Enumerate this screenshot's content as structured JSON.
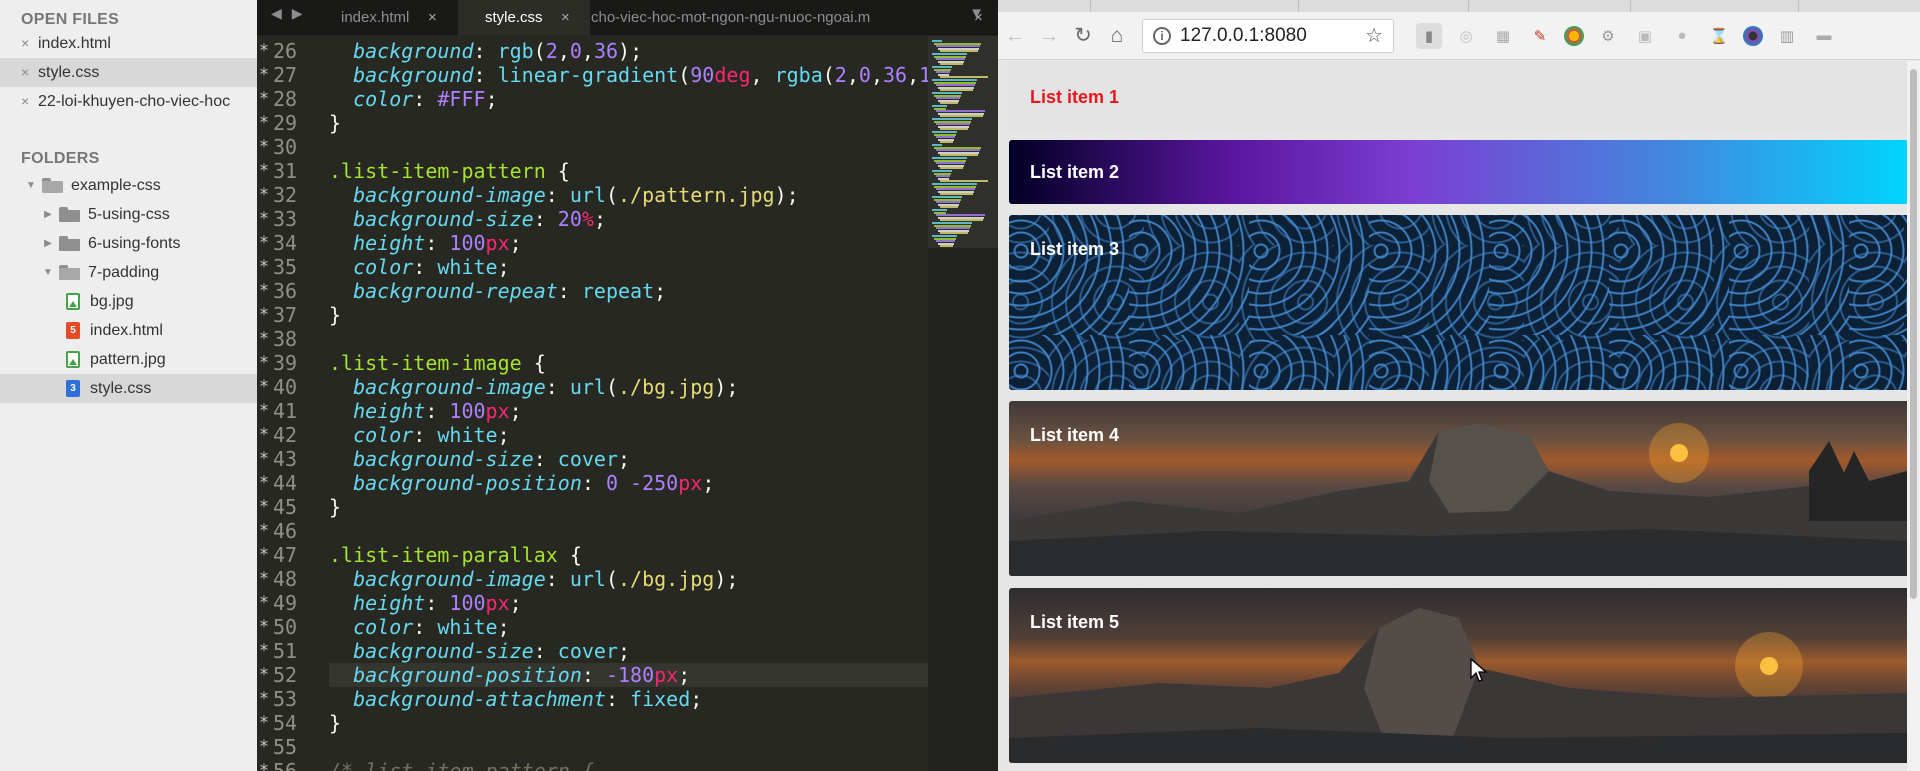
{
  "sidebar": {
    "open_files_heading": "OPEN FILES",
    "open_files": [
      {
        "name": "index.html",
        "selected": false
      },
      {
        "name": "style.css",
        "selected": true
      },
      {
        "name": "22-loi-khuyen-cho-viec-hoc",
        "selected": false
      }
    ],
    "folders_heading": "FOLDERS",
    "tree": [
      {
        "name": "example-css",
        "type": "folder",
        "open": true,
        "depth": 0,
        "icon": "folder-open-icon",
        "selected": false
      },
      {
        "name": "5-using-css",
        "type": "folder",
        "open": false,
        "depth": 1,
        "icon": "folder-icon",
        "selected": false
      },
      {
        "name": "6-using-fonts",
        "type": "folder",
        "open": false,
        "depth": 1,
        "icon": "folder-icon",
        "selected": false
      },
      {
        "name": "7-padding",
        "type": "folder",
        "open": true,
        "depth": 1,
        "icon": "folder-open-icon",
        "selected": false
      },
      {
        "name": "bg.jpg",
        "type": "image",
        "depth": 2,
        "icon": "image-file-icon",
        "selected": false
      },
      {
        "name": "index.html",
        "type": "html",
        "depth": 2,
        "icon": "html-file-icon",
        "selected": false
      },
      {
        "name": "pattern.jpg",
        "type": "image",
        "depth": 2,
        "icon": "image-file-icon",
        "selected": false
      },
      {
        "name": "style.css",
        "type": "css",
        "depth": 2,
        "icon": "css-file-icon",
        "selected": true
      }
    ]
  },
  "editor": {
    "tabs": [
      {
        "label": "index.html",
        "active": false
      },
      {
        "label": "style.css",
        "active": true
      },
      {
        "label": "cho-viec-hoc-mot-ngon-ngu-nuoc-ngoai.m",
        "active": false
      }
    ],
    "highlighted_line": 52,
    "lines": [
      {
        "n": "26",
        "tokens": [
          [
            "k",
            "  background"
          ],
          [
            "p",
            ": "
          ],
          [
            "f",
            "rgb"
          ],
          [
            "p",
            "("
          ],
          [
            "v",
            "2"
          ],
          [
            "p",
            ","
          ],
          [
            "v",
            "0"
          ],
          [
            "p",
            ","
          ],
          [
            "v",
            "36"
          ],
          [
            "p",
            ");"
          ]
        ]
      },
      {
        "n": "27",
        "tokens": [
          [
            "k",
            "  background"
          ],
          [
            "p",
            ": "
          ],
          [
            "f",
            "linear-gradient"
          ],
          [
            "p",
            "("
          ],
          [
            "v",
            "90"
          ],
          [
            "u",
            "deg"
          ],
          [
            "p",
            ", "
          ],
          [
            "f",
            "rgba"
          ],
          [
            "p",
            "("
          ],
          [
            "v",
            "2"
          ],
          [
            "p",
            ","
          ],
          [
            "v",
            "0"
          ],
          [
            "p",
            ","
          ],
          [
            "v",
            "36"
          ],
          [
            "p",
            ","
          ],
          [
            "v",
            "1"
          ]
        ]
      },
      {
        "n": "28",
        "tokens": [
          [
            "k",
            "  color"
          ],
          [
            "p",
            ": "
          ],
          [
            "v",
            "#FFF"
          ],
          [
            "p",
            ";"
          ]
        ]
      },
      {
        "n": "29",
        "tokens": [
          [
            "p",
            "}"
          ]
        ]
      },
      {
        "n": "30",
        "tokens": []
      },
      {
        "n": "31",
        "tokens": [
          [
            "s",
            ".list-item-pattern"
          ],
          [
            "p",
            " {"
          ]
        ]
      },
      {
        "n": "32",
        "tokens": [
          [
            "k",
            "  background-image"
          ],
          [
            "p",
            ": "
          ],
          [
            "f",
            "url"
          ],
          [
            "p",
            "("
          ],
          [
            "str",
            "./pattern.jpg"
          ],
          [
            "p",
            ");"
          ]
        ]
      },
      {
        "n": "33",
        "tokens": [
          [
            "k",
            "  background-size"
          ],
          [
            "p",
            ": "
          ],
          [
            "v",
            "20"
          ],
          [
            "u",
            "%"
          ],
          [
            "p",
            ";"
          ]
        ]
      },
      {
        "n": "34",
        "tokens": [
          [
            "k",
            "  height"
          ],
          [
            "p",
            ": "
          ],
          [
            "v",
            "100"
          ],
          [
            "u",
            "px"
          ],
          [
            "p",
            ";"
          ]
        ]
      },
      {
        "n": "35",
        "tokens": [
          [
            "k",
            "  color"
          ],
          [
            "p",
            ": "
          ],
          [
            "f",
            "white"
          ],
          [
            "p",
            ";"
          ]
        ]
      },
      {
        "n": "36",
        "tokens": [
          [
            "k",
            "  background-repeat"
          ],
          [
            "p",
            ": "
          ],
          [
            "f",
            "repeat"
          ],
          [
            "p",
            ";"
          ]
        ]
      },
      {
        "n": "37",
        "tokens": [
          [
            "p",
            "}"
          ]
        ]
      },
      {
        "n": "38",
        "tokens": []
      },
      {
        "n": "39",
        "tokens": [
          [
            "s",
            ".list-item-image"
          ],
          [
            "p",
            " {"
          ]
        ]
      },
      {
        "n": "40",
        "tokens": [
          [
            "k",
            "  background-image"
          ],
          [
            "p",
            ": "
          ],
          [
            "f",
            "url"
          ],
          [
            "p",
            "("
          ],
          [
            "str",
            "./bg.jpg"
          ],
          [
            "p",
            ");"
          ]
        ]
      },
      {
        "n": "41",
        "tokens": [
          [
            "k",
            "  height"
          ],
          [
            "p",
            ": "
          ],
          [
            "v",
            "100"
          ],
          [
            "u",
            "px"
          ],
          [
            "p",
            ";"
          ]
        ]
      },
      {
        "n": "42",
        "tokens": [
          [
            "k",
            "  color"
          ],
          [
            "p",
            ": "
          ],
          [
            "f",
            "white"
          ],
          [
            "p",
            ";"
          ]
        ]
      },
      {
        "n": "43",
        "tokens": [
          [
            "k",
            "  background-size"
          ],
          [
            "p",
            ": "
          ],
          [
            "f",
            "cover"
          ],
          [
            "p",
            ";"
          ]
        ]
      },
      {
        "n": "44",
        "tokens": [
          [
            "k",
            "  background-position"
          ],
          [
            "p",
            ": "
          ],
          [
            "v",
            "0 -250"
          ],
          [
            "u",
            "px"
          ],
          [
            "p",
            ";"
          ]
        ]
      },
      {
        "n": "45",
        "tokens": [
          [
            "p",
            "}"
          ]
        ]
      },
      {
        "n": "46",
        "tokens": []
      },
      {
        "n": "47",
        "tokens": [
          [
            "s",
            ".list-item-parallax"
          ],
          [
            "p",
            " {"
          ]
        ]
      },
      {
        "n": "48",
        "tokens": [
          [
            "k",
            "  background-image"
          ],
          [
            "p",
            ": "
          ],
          [
            "f",
            "url"
          ],
          [
            "p",
            "("
          ],
          [
            "str",
            "./bg.jpg"
          ],
          [
            "p",
            ");"
          ]
        ]
      },
      {
        "n": "49",
        "tokens": [
          [
            "k",
            "  height"
          ],
          [
            "p",
            ": "
          ],
          [
            "v",
            "100"
          ],
          [
            "u",
            "px"
          ],
          [
            "p",
            ";"
          ]
        ]
      },
      {
        "n": "50",
        "tokens": [
          [
            "k",
            "  color"
          ],
          [
            "p",
            ": "
          ],
          [
            "f",
            "white"
          ],
          [
            "p",
            ";"
          ]
        ]
      },
      {
        "n": "51",
        "tokens": [
          [
            "k",
            "  background-size"
          ],
          [
            "p",
            ": "
          ],
          [
            "f",
            "cover"
          ],
          [
            "p",
            ";"
          ]
        ]
      },
      {
        "n": "52",
        "tokens": [
          [
            "k",
            "  background-position"
          ],
          [
            "p",
            ": "
          ],
          [
            "v",
            "-180"
          ],
          [
            "u",
            "px"
          ],
          [
            "p",
            ";"
          ]
        ]
      },
      {
        "n": "53",
        "tokens": [
          [
            "k",
            "  background-attachment"
          ],
          [
            "p",
            ": "
          ],
          [
            "f",
            "fixed"
          ],
          [
            "p",
            ";"
          ]
        ]
      },
      {
        "n": "54",
        "tokens": [
          [
            "p",
            "}"
          ]
        ]
      },
      {
        "n": "55",
        "tokens": []
      },
      {
        "n": "56",
        "tokens": [
          [
            "cm",
            "/* list-item-pattern {"
          ]
        ]
      }
    ]
  },
  "browser": {
    "url": "127.0.0.1:8080",
    "list_items": [
      "List item 1",
      "List item 2",
      "List item 3",
      "List item 4",
      "List item 5"
    ]
  }
}
